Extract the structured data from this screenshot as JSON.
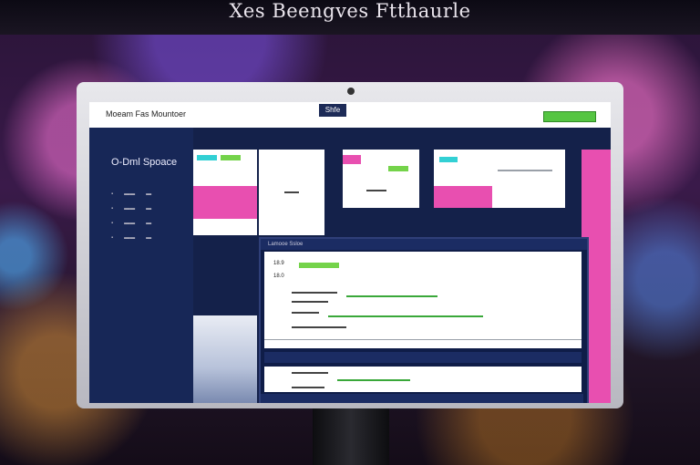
{
  "headline": "Xes Beengves Ftthaurle",
  "screen": {
    "topbar": {
      "brand": "Moeam Fas Mountoer",
      "logo": "Shfe"
    },
    "sidebar": {
      "title": "O-Dml Spoace"
    },
    "dialog": {
      "header": "Lamooe Ssloe",
      "row1": "18.9",
      "row2": "18.0"
    }
  }
}
